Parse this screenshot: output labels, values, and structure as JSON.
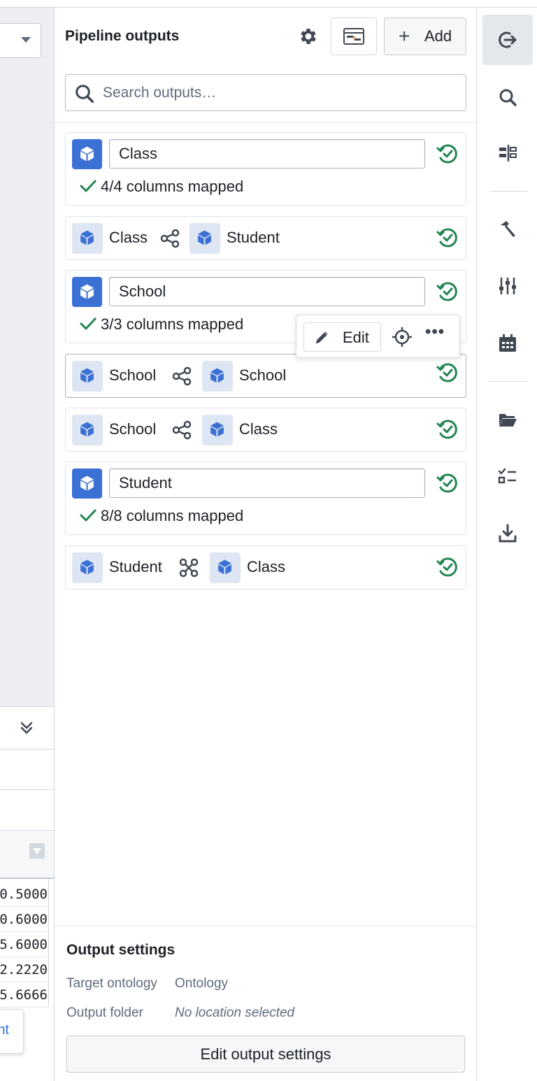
{
  "left_panel": {
    "values": [
      "0.5000",
      "0.6000",
      "5.6000",
      "2.2220",
      "5.6666"
    ],
    "popover_text": "nt"
  },
  "panel": {
    "title": "Pipeline outputs",
    "add_label": "Add",
    "search_placeholder": "Search outputs…",
    "outputs": [
      {
        "kind": "object",
        "name": "Class",
        "mapped": "4/4 columns mapped"
      },
      {
        "kind": "link",
        "from": "Class",
        "to": "Student",
        "link_icon": "one-to-many-icon"
      },
      {
        "kind": "object",
        "name": "School",
        "mapped": "3/3 columns mapped"
      },
      {
        "kind": "link",
        "from": "School",
        "to": "School",
        "link_icon": "one-to-many-icon"
      },
      {
        "kind": "link",
        "from": "School",
        "to": "Class",
        "link_icon": "one-to-many-icon"
      },
      {
        "kind": "object",
        "name": "Student",
        "mapped": "8/8 columns mapped"
      },
      {
        "kind": "link",
        "from": "Student",
        "to": "Class",
        "link_icon": "many-to-many-icon"
      }
    ],
    "hover_actions": {
      "edit_label": "Edit"
    },
    "output_settings": {
      "title": "Output settings",
      "target_ontology_label": "Target ontology",
      "target_ontology_value": "Ontology",
      "output_folder_label": "Output folder",
      "output_folder_value": "No location selected",
      "edit_button": "Edit output settings"
    }
  },
  "right_rail": {
    "icons": [
      "export-icon",
      "search-icon",
      "align-icon",
      "hammer-icon",
      "sliders-icon",
      "calendar-icon",
      "folder-icon",
      "checklist-icon",
      "download-icon"
    ]
  },
  "colors": {
    "accent_blue": "#3b70d4",
    "success_green": "#238551",
    "text": "#1c2127",
    "muted": "#5f6b7c"
  }
}
